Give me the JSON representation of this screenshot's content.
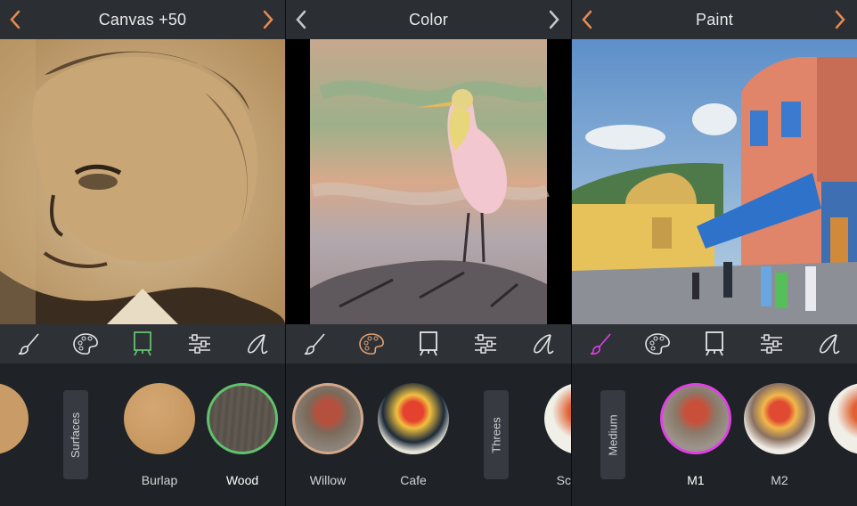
{
  "panels": [
    {
      "title": "Canvas +50",
      "accent": "#61c26c",
      "tools": [
        "brush-icon",
        "palette-icon",
        "canvas-icon",
        "sliders-icon",
        "script-a-icon"
      ],
      "active_tool": 2,
      "category_tab": "Surfaces",
      "items": [
        {
          "label": "",
          "color": "#c99c67"
        },
        {
          "label": "Burlap",
          "color": "#c79a64"
        },
        {
          "label": "Wood",
          "color": "#5d5750"
        }
      ]
    },
    {
      "title": "Color",
      "accent": "#e0a074",
      "tools": [
        "brush-icon",
        "palette-icon",
        "canvas-icon",
        "sliders-icon",
        "script-a-icon"
      ],
      "active_tool": 1,
      "category_tab": "Threes",
      "items": [
        {
          "label": "Willow"
        },
        {
          "label": "Cafe"
        },
        {
          "label": "Sc"
        }
      ]
    },
    {
      "title": "Paint",
      "accent": "#e040e6",
      "tools": [
        "brush-icon",
        "palette-icon",
        "canvas-icon",
        "sliders-icon",
        "script-a-icon"
      ],
      "active_tool": 0,
      "category_tab": "Medium",
      "items": [
        {
          "label": "M1"
        },
        {
          "label": "M2"
        }
      ]
    }
  ],
  "chevron_color": "#e68b4f"
}
